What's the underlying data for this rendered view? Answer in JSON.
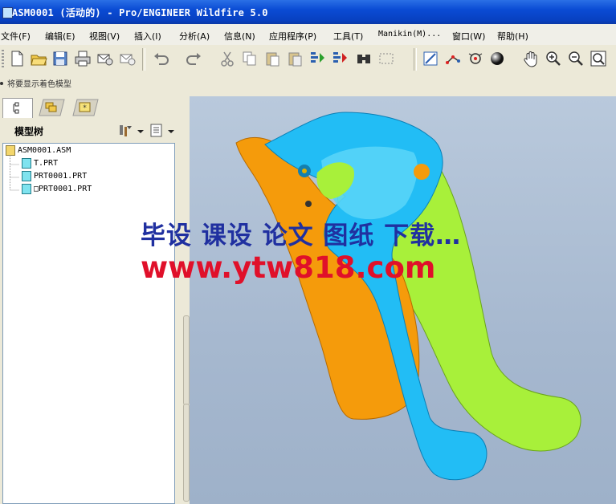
{
  "window": {
    "title": "ASM0001 (活动的) - Pro/ENGINEER Wildfire 5.0"
  },
  "menu": [
    {
      "label": "文件(F)"
    },
    {
      "label": "编辑(E)"
    },
    {
      "label": "视图(V)"
    },
    {
      "label": "插入(I)"
    },
    {
      "label": "分析(A)"
    },
    {
      "label": "信息(N)"
    },
    {
      "label": "应用程序(P)"
    },
    {
      "label": "工具(T)"
    },
    {
      "label": "Manikin(M)..."
    },
    {
      "label": "窗口(W)"
    },
    {
      "label": "帮助(H)"
    }
  ],
  "toolbar": {
    "icons": [
      "new-file-icon",
      "open-folder-icon",
      "save-icon",
      "print-icon",
      "send-mail-icon",
      "mail-settings-icon",
      "undo-icon",
      "redo-icon",
      "cut-icon",
      "copy-icon",
      "paste-icon",
      "paste-special-icon",
      "regenerate-icon",
      "regenerate-manager-icon",
      "find-icon",
      "select-box-icon",
      "sketch-view-icon",
      "datum-display-icon",
      "spin-center-icon",
      "shading-icon",
      "pan-hand-icon",
      "zoom-in-icon",
      "zoom-out-icon",
      "refit-icon"
    ]
  },
  "message": {
    "text": "将要显示着色模型"
  },
  "panel": {
    "title": "模型树",
    "tabs": [
      "model-tree-tab",
      "folder-browser-tab",
      "favorites-tab"
    ],
    "tree": [
      {
        "label": "ASM0001.ASM",
        "type": "assembly"
      },
      {
        "label": "T.PRT",
        "type": "part"
      },
      {
        "label": "PRT0001.PRT",
        "type": "part"
      },
      {
        "label": "□PRT0001.PRT",
        "type": "part"
      }
    ]
  },
  "watermark": {
    "line1": "毕设 课设 论文 图纸 下载…",
    "line2": "www.ytw818.com"
  },
  "colors": {
    "accent_blue": "#0a4bd4",
    "part_orange": "#f59b0b",
    "part_cyan": "#22bdf5",
    "part_green": "#a8f03a"
  }
}
